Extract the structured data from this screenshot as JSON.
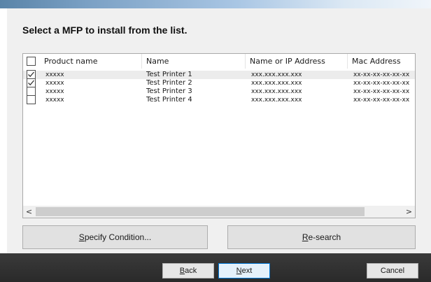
{
  "heading": "Select a MFP to install from the list.",
  "list": {
    "columns": [
      "Product name",
      "Name",
      "Name or IP Address",
      "Mac Address"
    ],
    "rows": [
      {
        "checked": true,
        "product": "xxxxx",
        "name": "Test Printer 1",
        "ip": "xxx.xxx.xxx.xxx",
        "mac": "xx-xx-xx-xx-xx-xx"
      },
      {
        "checked": true,
        "product": "xxxxx",
        "name": "Test Printer 2",
        "ip": "xxx.xxx.xxx.xxx",
        "mac": "xx-xx-xx-xx-xx-xx"
      },
      {
        "checked": false,
        "product": "xxxxx",
        "name": "Test Printer 3",
        "ip": "xxx.xxx.xxx.xxx",
        "mac": "xx-xx-xx-xx-xx-xx"
      },
      {
        "checked": false,
        "product": "xxxxx",
        "name": "Test Printer 4",
        "ip": "xxx.xxx.xxx.xxx",
        "mac": "xx-xx-xx-xx-xx-xx"
      }
    ]
  },
  "buttons": {
    "specify_first": "S",
    "specify_rest": "pecify Condition...",
    "research_first": "R",
    "research_rest": "e-search",
    "back_first": "B",
    "back_rest": "ack",
    "next_first": "N",
    "next_rest": "ext",
    "cancel": "Cancel"
  },
  "scroll": {
    "left": "<",
    "right": ">"
  }
}
